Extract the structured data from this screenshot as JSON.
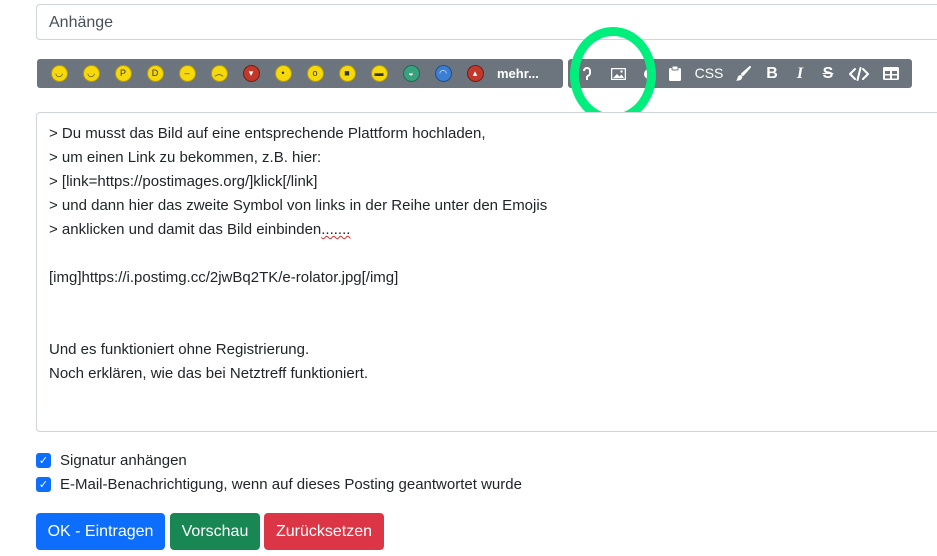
{
  "attachments": {
    "label": "Anhänge"
  },
  "emoji_toolbar": {
    "emojis": [
      {
        "icon": "emoji-smile-icon",
        "glyph": "◡"
      },
      {
        "icon": "emoji-wink-icon",
        "glyph": "◡"
      },
      {
        "icon": "emoji-tongue-icon",
        "glyph": "P"
      },
      {
        "icon": "emoji-grin-icon",
        "glyph": "D"
      },
      {
        "icon": "emoji-neutral-icon",
        "glyph": "–"
      },
      {
        "icon": "emoji-sad-icon",
        "glyph": "︵"
      },
      {
        "icon": "emoji-devil-icon",
        "glyph": "▾"
      },
      {
        "icon": "emoji-bee-icon",
        "glyph": "•"
      },
      {
        "icon": "emoji-eyeroll-icon",
        "glyph": "o"
      },
      {
        "icon": "emoji-cool-icon",
        "glyph": "■"
      },
      {
        "icon": "emoji-sunglasses-icon",
        "glyph": "▬"
      },
      {
        "icon": "emoji-cap-icon",
        "glyph": "◒"
      },
      {
        "icon": "emoji-crying-icon",
        "glyph": "◠"
      },
      {
        "icon": "emoji-angry-devil-icon",
        "glyph": "▴"
      }
    ],
    "more_label": "mehr..."
  },
  "format_toolbar": {
    "css_label": "CSS",
    "bold_label": "B",
    "italic_label": "I",
    "strike_label": "S"
  },
  "editor": {
    "lines": [
      "> Du musst das Bild auf eine entsprechende Plattform hochladen,",
      "> um einen Link zu bekommen, z.B. hier:",
      "> [link=https://postimages.org/]klick[/link]",
      "> und dann hier das zweite Symbol von links in der Reihe unter den Emojis",
      "> anklicken und damit das Bild einbinden",
      "",
      "[img]https://i.postimg.cc/2jwBq2TK/e-rolator.jpg[/img]",
      "",
      "",
      "Und es funktioniert ohne Registrierung.",
      "Noch erklären, wie das bei Netztreff funktioniert."
    ],
    "dots": "......."
  },
  "options": {
    "signature_label": "Signatur anhängen",
    "notify_label": "E-Mail-Benachrichtigung, wenn auf dieses Posting geantwortet wurde"
  },
  "buttons": {
    "submit_label": "OK - Eintragen",
    "preview_label": "Vorschau",
    "reset_label": "Zurücksetzen"
  },
  "colors": {
    "primary": "#0d6efd",
    "success": "#198754",
    "danger": "#dc3545",
    "toolbar": "#6c757d",
    "highlight": "#00ef7c"
  }
}
